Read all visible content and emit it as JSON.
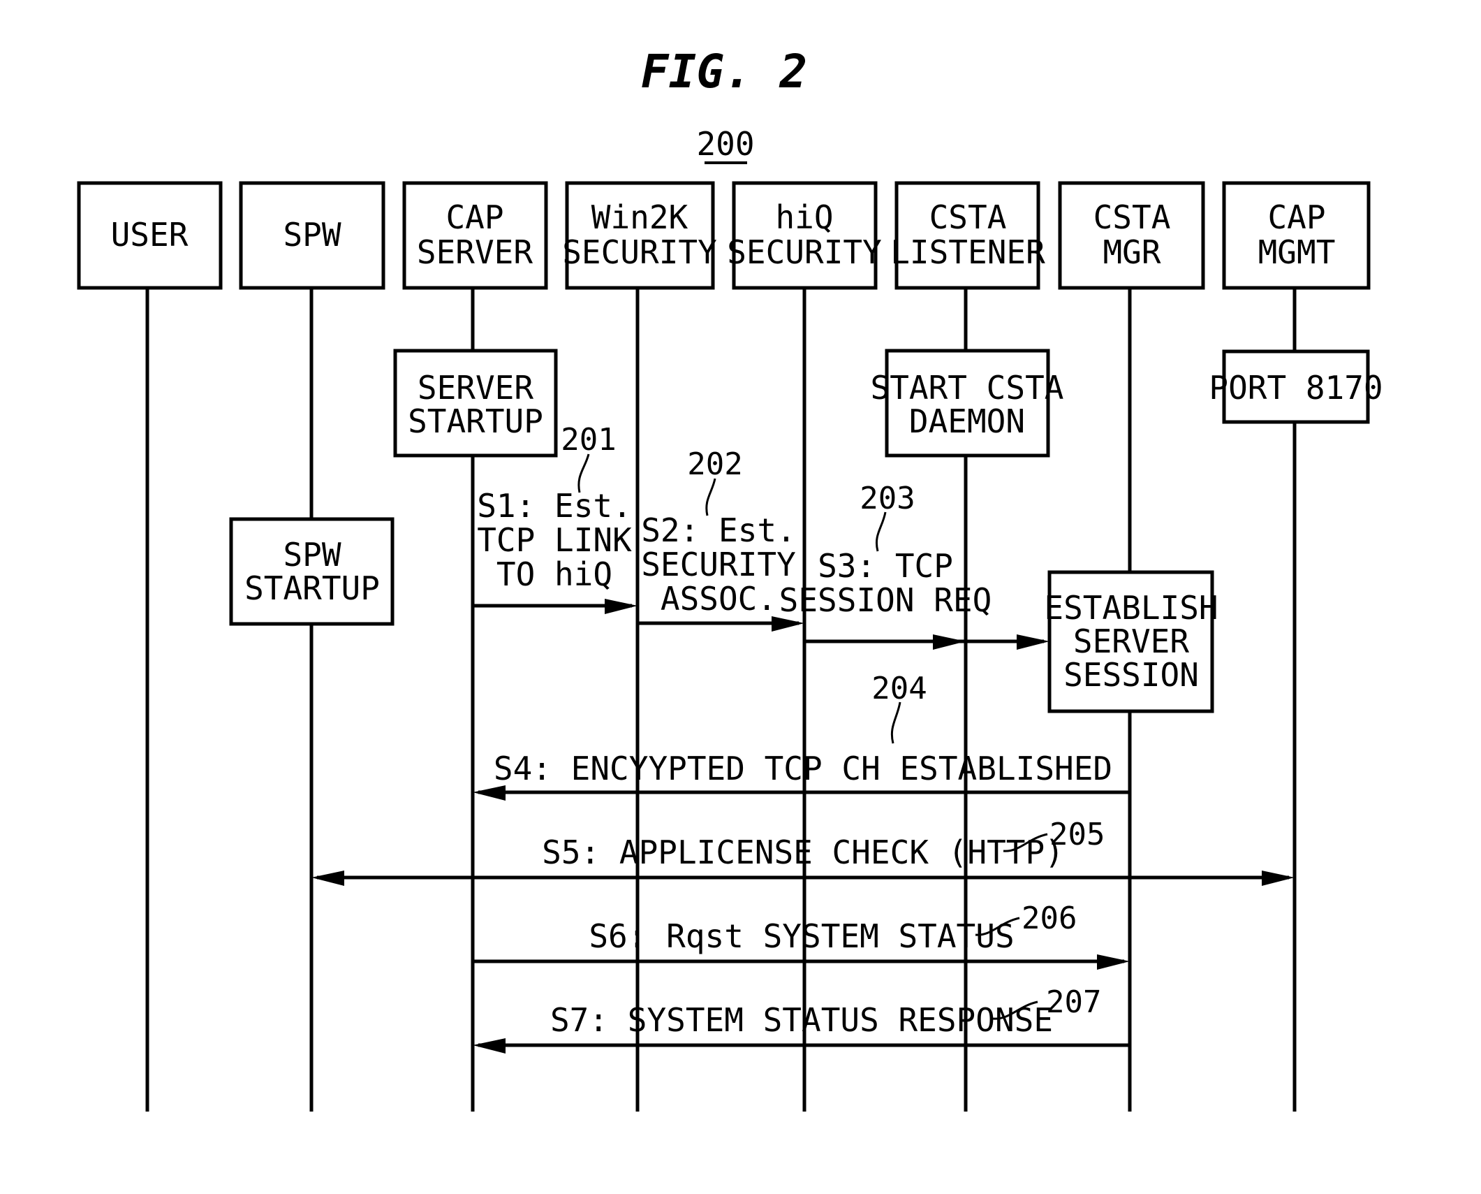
{
  "figure": {
    "title": "FIG. 2",
    "reference": "200"
  },
  "participants": [
    {
      "id": "user",
      "lines": [
        "USER"
      ]
    },
    {
      "id": "spw",
      "lines": [
        "SPW"
      ]
    },
    {
      "id": "cap-server",
      "lines": [
        "CAP",
        "SERVER"
      ]
    },
    {
      "id": "win2k-security",
      "lines": [
        "Win2K",
        "SECURITY"
      ]
    },
    {
      "id": "hiq-security",
      "lines": [
        "hiQ",
        "SECURITY"
      ]
    },
    {
      "id": "csta-listener",
      "lines": [
        "CSTA",
        "LISTENER"
      ]
    },
    {
      "id": "csta-mgr",
      "lines": [
        "CSTA",
        "MGR"
      ]
    },
    {
      "id": "cap-mgmt",
      "lines": [
        "CAP",
        "MGMT"
      ]
    }
  ],
  "activities": [
    {
      "id": "server-startup",
      "participant": "cap-server",
      "lines": [
        "SERVER",
        "STARTUP"
      ]
    },
    {
      "id": "start-csta-daemon",
      "participant": "csta-listener",
      "lines": [
        "START CSTA",
        "DAEMON"
      ]
    },
    {
      "id": "port-8170",
      "participant": "cap-mgmt",
      "lines": [
        "PORT 8170"
      ]
    },
    {
      "id": "spw-startup",
      "participant": "spw",
      "lines": [
        "SPW",
        "STARTUP"
      ]
    },
    {
      "id": "establish-server-session",
      "participant": "csta-mgr",
      "lines": [
        "ESTABLISH",
        "SERVER",
        "SESSION"
      ]
    }
  ],
  "messages": [
    {
      "id": "s1",
      "ref": "201",
      "from": "cap-server",
      "to": "win2k-security",
      "lines": [
        "S1: Est.",
        "TCP LINK",
        "TO hiQ"
      ]
    },
    {
      "id": "s2",
      "ref": "202",
      "from": "win2k-security",
      "to": "hiq-security",
      "lines": [
        "S2: Est.",
        "SECURITY",
        "ASSOC."
      ]
    },
    {
      "id": "s3",
      "ref": "203",
      "from": "hiq-security",
      "to": "csta-mgr",
      "lines": [
        "S3: TCP",
        "SESSION REQ"
      ]
    },
    {
      "id": "s4",
      "ref": "204",
      "from": "csta-mgr",
      "to": "cap-server",
      "lines": [
        "S4: ENCYYPTED TCP CH ESTABLISHED"
      ]
    },
    {
      "id": "s5",
      "ref": "205",
      "from": "spw",
      "to": "cap-mgmt",
      "bidirectional": true,
      "lines": [
        "S5: APPLICENSE CHECK (HTTP)"
      ]
    },
    {
      "id": "s6",
      "ref": "206",
      "from": "cap-server",
      "to": "csta-mgr",
      "lines": [
        "S6: Rqst SYSTEM STATUS"
      ]
    },
    {
      "id": "s7",
      "ref": "207",
      "from": "csta-mgr",
      "to": "cap-server",
      "lines": [
        "S7: SYSTEM STATUS RESPONSE"
      ]
    }
  ]
}
